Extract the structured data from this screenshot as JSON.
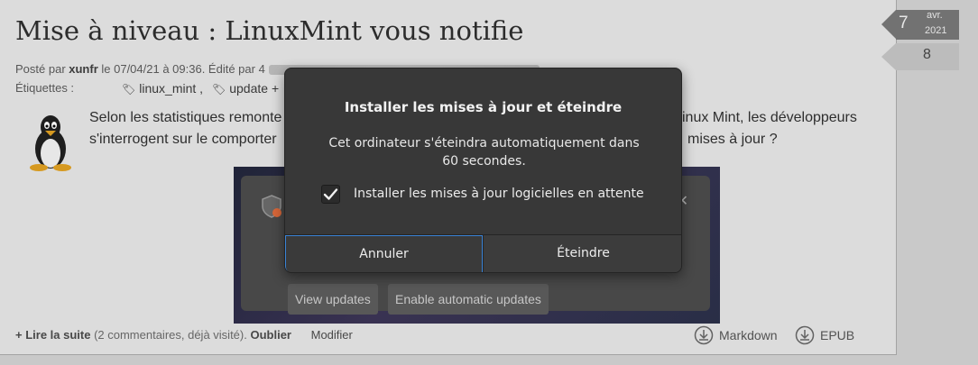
{
  "article": {
    "title": "Mise à niveau : LinuxMint vous notifie",
    "meta_prefix": "Posté par ",
    "author": "xunfr",
    "meta_date": " le 07/04/21 à 09:36. Édité par 4",
    "tags_label": "Étiquettes :",
    "tags": [
      "linux_mint ,",
      "update +"
    ],
    "body_left_line1": "Selon les statistiques remonte",
    "body_left_line2": "s'interrogent sur le comporter",
    "body_right_line1": "inux Mint, les développeurs",
    "body_right_line2": "mises à jour ?",
    "read_more": "+ Lire la suite",
    "comments_info": " (2 commentaires, déjà visité).",
    "forget": "Oublier",
    "modify": "Modifier",
    "markdown": "Markdown",
    "epub": "EPUB"
  },
  "badge": {
    "day": "7",
    "month": "avr.",
    "year": "2021",
    "score": "8"
  },
  "embedded_screenshot": {
    "view_updates": "View updates",
    "enable_auto": "Enable automatic updates"
  },
  "dialog": {
    "title": "Installer les mises à jour et éteindre",
    "message": "Cet ordinateur s'éteindra automatiquement dans 60 secondes.",
    "checkbox_label": "Installer les mises à jour logicielles en attente",
    "checkbox_checked": true,
    "cancel_label": "Annuler",
    "shutdown_label": "Éteindre",
    "focus_color": "#3a83d6"
  }
}
